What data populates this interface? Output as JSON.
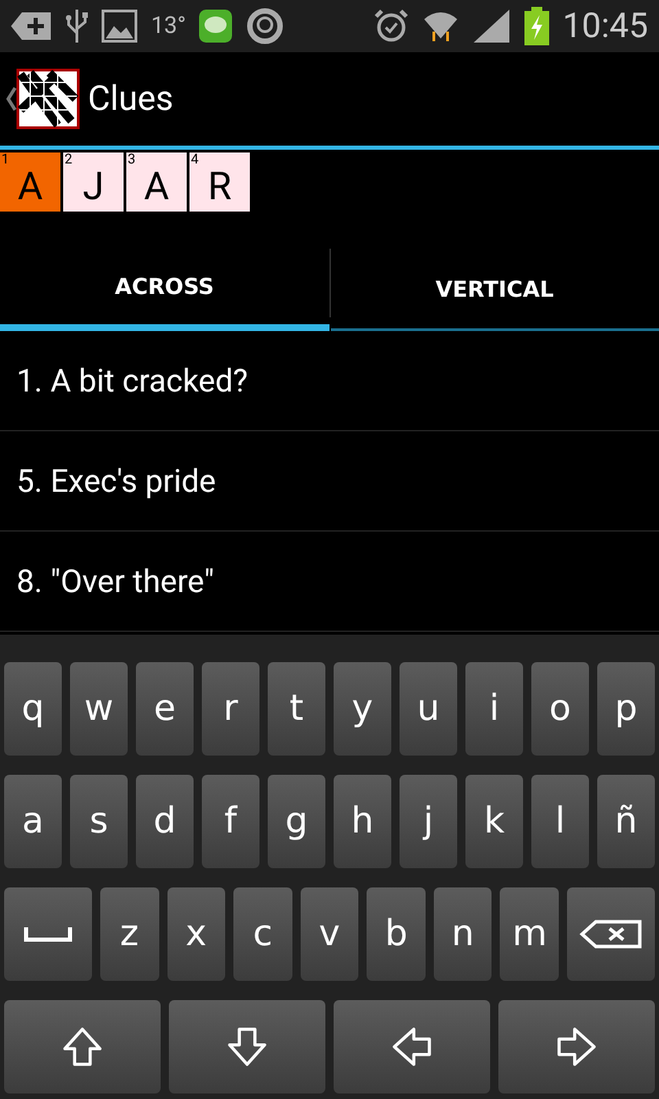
{
  "status_bar": {
    "temperature": "13°",
    "time": "10:45"
  },
  "header": {
    "title": "Clues"
  },
  "grid": [
    {
      "number": "1",
      "letter": "A",
      "selected": true
    },
    {
      "number": "2",
      "letter": "J",
      "selected": false
    },
    {
      "number": "3",
      "letter": "A",
      "selected": false
    },
    {
      "number": "4",
      "letter": "R",
      "selected": false
    }
  ],
  "tabs": [
    {
      "label": "ACROSS",
      "selected": true
    },
    {
      "label": "VERTICAL",
      "selected": false
    }
  ],
  "clues": [
    {
      "text": "1. A bit cracked?"
    },
    {
      "text": "5. Exec's pride"
    },
    {
      "text": "8. \"Over there\""
    }
  ],
  "keyboard": [
    [
      {
        "kind": "char",
        "label": "q"
      },
      {
        "kind": "char",
        "label": "w"
      },
      {
        "kind": "char",
        "label": "e"
      },
      {
        "kind": "char",
        "label": "r"
      },
      {
        "kind": "char",
        "label": "t"
      },
      {
        "kind": "char",
        "label": "y"
      },
      {
        "kind": "char",
        "label": "u"
      },
      {
        "kind": "char",
        "label": "i"
      },
      {
        "kind": "char",
        "label": "o"
      },
      {
        "kind": "char",
        "label": "p"
      }
    ],
    [
      {
        "kind": "char",
        "label": "a"
      },
      {
        "kind": "char",
        "label": "s"
      },
      {
        "kind": "char",
        "label": "d"
      },
      {
        "kind": "char",
        "label": "f"
      },
      {
        "kind": "char",
        "label": "g"
      },
      {
        "kind": "char",
        "label": "h"
      },
      {
        "kind": "char",
        "label": "j"
      },
      {
        "kind": "char",
        "label": "k"
      },
      {
        "kind": "char",
        "label": "l"
      },
      {
        "kind": "char",
        "label": "ñ"
      }
    ],
    [
      {
        "kind": "space"
      },
      {
        "kind": "char",
        "label": "z"
      },
      {
        "kind": "char",
        "label": "x"
      },
      {
        "kind": "char",
        "label": "c"
      },
      {
        "kind": "char",
        "label": "v"
      },
      {
        "kind": "char",
        "label": "b"
      },
      {
        "kind": "char",
        "label": "n"
      },
      {
        "kind": "char",
        "label": "m"
      },
      {
        "kind": "backspace"
      }
    ],
    [
      {
        "kind": "up"
      },
      {
        "kind": "down"
      },
      {
        "kind": "left"
      },
      {
        "kind": "right"
      }
    ]
  ]
}
